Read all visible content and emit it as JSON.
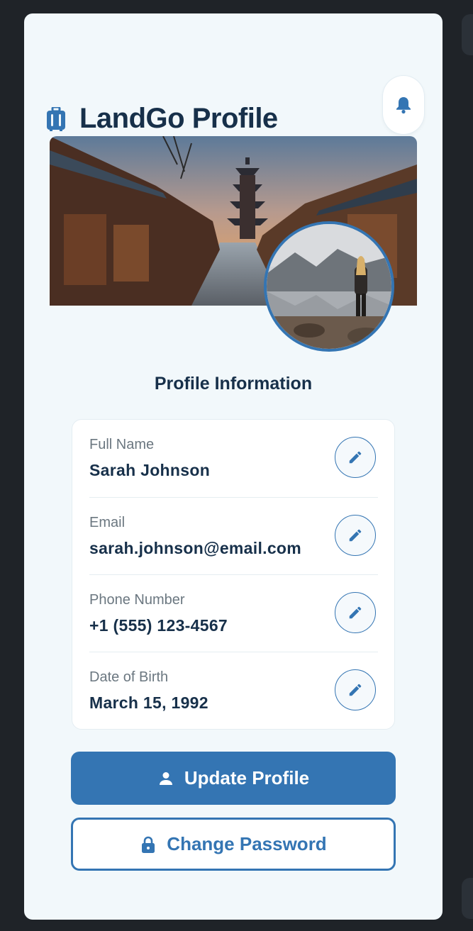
{
  "app": {
    "title": "LandGo Profile",
    "brand_icon": "luggage-icon",
    "notification_icon": "bell-icon"
  },
  "colors": {
    "accent": "#3475b3",
    "title": "#17304a",
    "background": "#1f2328",
    "card": "#f2f8fb"
  },
  "section_title": "Profile Information",
  "fields": [
    {
      "label": "Full Name",
      "value": "Sarah Johnson"
    },
    {
      "label": "Email",
      "value": "sarah.johnson@email.com"
    },
    {
      "label": "Phone Number",
      "value": "+1 (555) 123-4567"
    },
    {
      "label": "Date of Birth",
      "value": "March 15, 1992"
    }
  ],
  "actions": {
    "update_label": "Update Profile",
    "update_icon": "user-icon",
    "password_label": "Change Password",
    "password_icon": "lock-icon"
  }
}
